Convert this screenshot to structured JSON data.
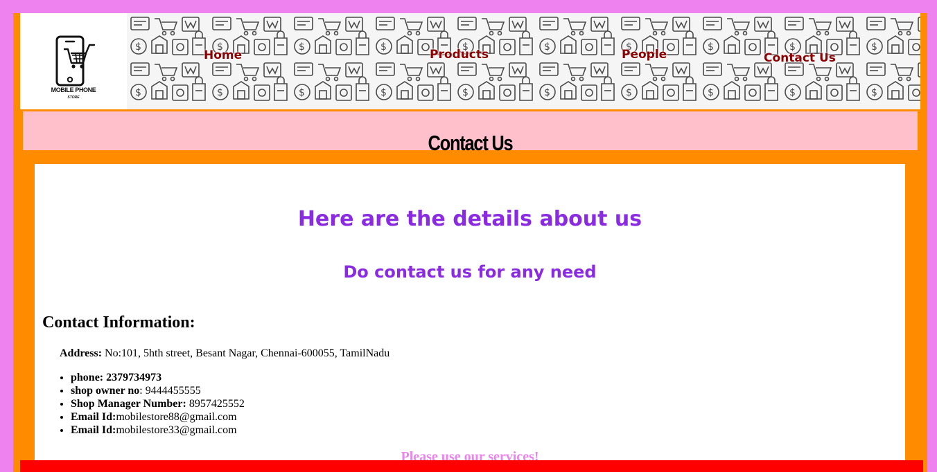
{
  "colors": {
    "page_border": "#ee82ee",
    "frame": "#ff8c00",
    "title_bar": "#ffc0cb",
    "nav_text": "#8b0000",
    "heading_purple": "#8a2be2",
    "closing_text": "#ee82ee",
    "footer": "#ff0000"
  },
  "logo": {
    "line1": "MOBILE PHONE",
    "line2": "STORE",
    "icon": "phone-cart-icon"
  },
  "header": {
    "background_pattern": "shopping-icons-pattern"
  },
  "nav": {
    "home": "Home",
    "products": "Products",
    "people": "People",
    "contact": "Contact Us"
  },
  "page": {
    "title": "Contact Us"
  },
  "content": {
    "heading": "Here are the details about us",
    "subheading": "Do contact us for any need",
    "info_title": "Contact Information:",
    "address_label": "Address:",
    "address_value": " No:101, 5hth street, Besant Nagar, Chennai-600055, TamilNadu",
    "contacts": [
      {
        "label": "phone: 2379734973",
        "value": ""
      },
      {
        "label": "shop owner no",
        "value": ": 9444455555"
      },
      {
        "label": "Shop Manager Number:",
        "value": " 8957425552"
      },
      {
        "label": "Email Id:",
        "value": "mobilestore88@gmail.com"
      },
      {
        "label": "Email Id:",
        "value": "mobilestore33@gmail.com"
      }
    ],
    "closing": "Please use our services!"
  }
}
